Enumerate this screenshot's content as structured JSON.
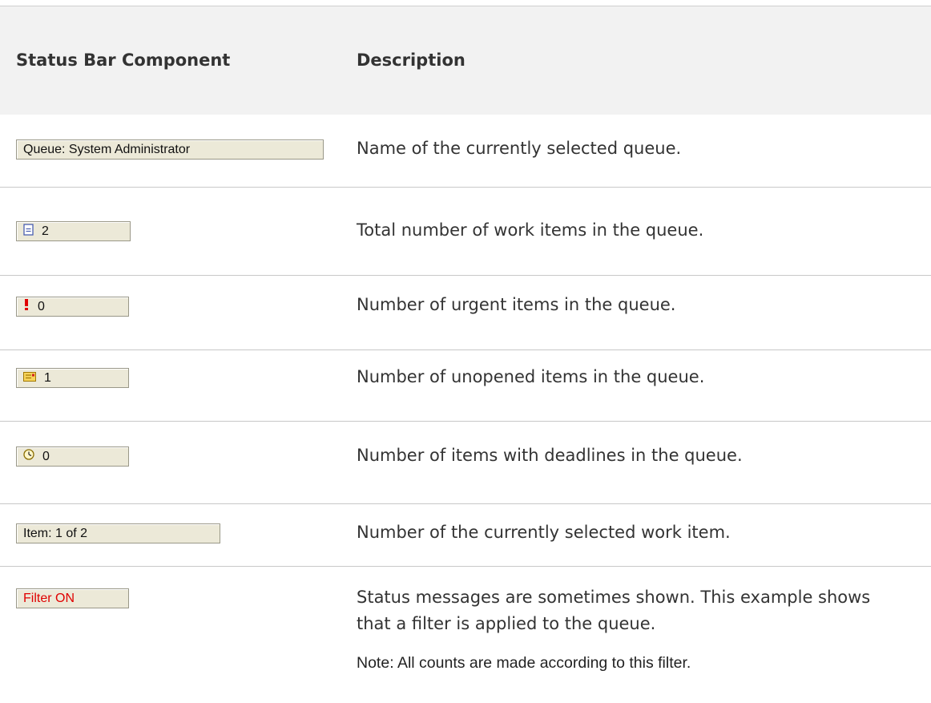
{
  "table": {
    "headers": {
      "component": "Status Bar Component",
      "description": "Description"
    },
    "rows": [
      {
        "panel_text": "Queue: System Administrator",
        "panel_icon": null,
        "description": "Name of the currently selected queue."
      },
      {
        "panel_text": "2",
        "panel_icon": "document-icon",
        "description": "Total number of work items in the queue."
      },
      {
        "panel_text": "0",
        "panel_icon": "exclamation-icon",
        "description": "Number of urgent items in the queue."
      },
      {
        "panel_text": "1",
        "panel_icon": "envelope-icon",
        "description": "Number of unopened items in the queue."
      },
      {
        "panel_text": "0",
        "panel_icon": "clock-icon",
        "description": "Number of items with deadlines in the queue."
      },
      {
        "panel_text": "Item: 1 of 2",
        "panel_icon": null,
        "description": "Number of the currently selected work item."
      },
      {
        "panel_text": "Filter ON",
        "panel_icon": null,
        "panel_text_color": "#e00000",
        "description": "Status messages are sometimes shown. This example shows that a filter is applied to the queue.",
        "note": "Note: All counts are made according to this filter."
      }
    ]
  }
}
